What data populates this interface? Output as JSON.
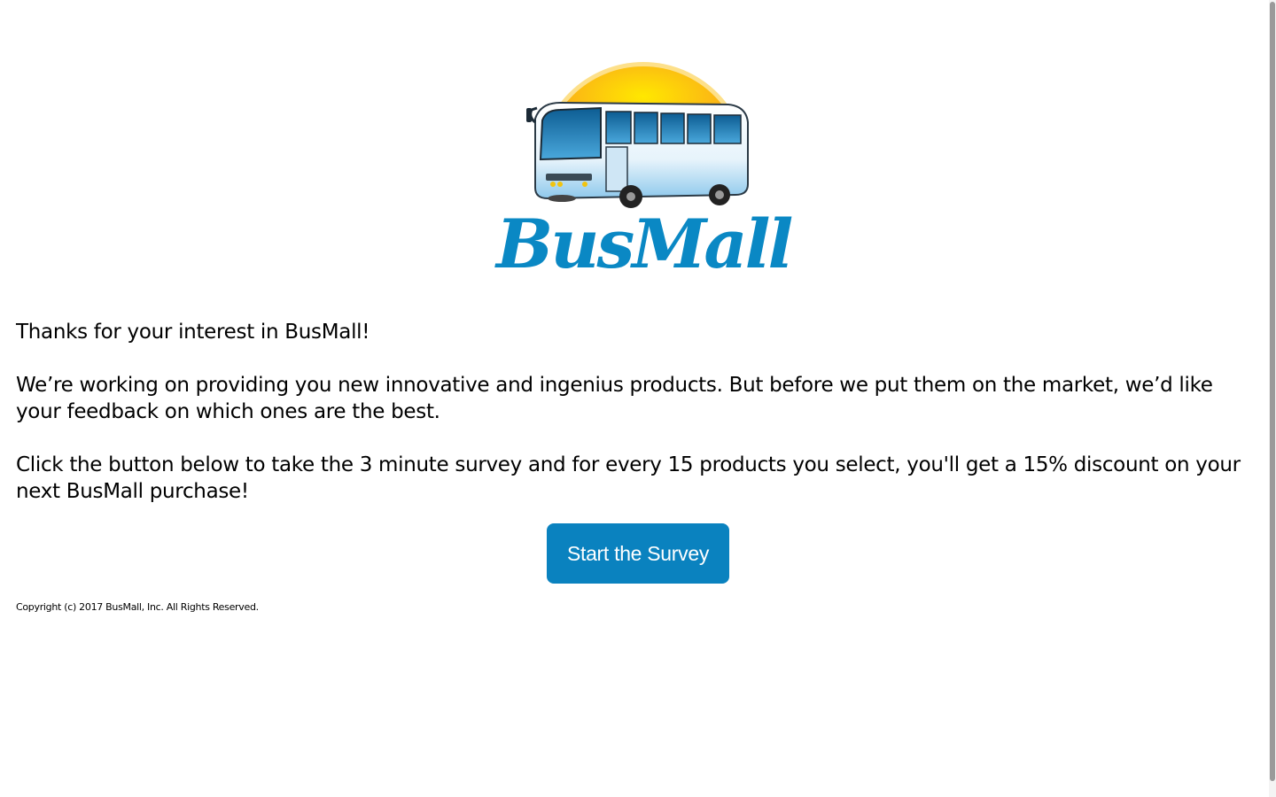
{
  "brand": {
    "logo_text": "BusMall",
    "logo_color": "#0a88c4",
    "sun_color": "#f7a21b"
  },
  "intro": {
    "line1": "Thanks for your interest in BusMall!",
    "line2": "We’re working on providing you new innovative and ingenius products. But before we put them on the market, we’d like your feedback on which ones are the best.",
    "line3": "Click the button below to take the 3 minute survey and for every 15 products you select, you'll get a 15% discount on your next BusMall purchase!"
  },
  "cta": {
    "label": "Start the Survey",
    "color": "#0a82bf"
  },
  "footer": {
    "copyright": "Copyright (c) 2017 BusMall, Inc. All Rights Reserved."
  }
}
